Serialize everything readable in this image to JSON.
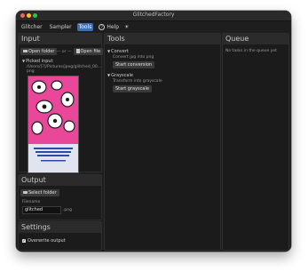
{
  "window": {
    "title": "GlitchedFactory"
  },
  "menu": {
    "items": [
      "Glitcher",
      "Sampler",
      "Tools",
      "Help"
    ],
    "active": "Tools"
  },
  "input_panel": {
    "heading": "Input",
    "open_folder_label": "Open folder",
    "or_separator": "— or —",
    "open_file_label": "Open file",
    "picked_input_label": "Picked input",
    "picked_path": "/Users/[?]/Pictures/jpeg/glitched_00…",
    "picked_path_ext": "png"
  },
  "output_panel": {
    "heading": "Output",
    "select_folder_label": "Select folder",
    "filename_label": "Filename",
    "filename_value": "glitched",
    "extension": ".png"
  },
  "settings_panel": {
    "heading": "Settings",
    "overwrite_label": "Overwrite output",
    "overwrite_checked": true
  },
  "tools_panel": {
    "heading": "Tools",
    "convert": {
      "title": "Convert",
      "description": "Convert jpg into png",
      "button": "Start conversion"
    },
    "grayscale": {
      "title": "Grayscale",
      "description": "Transform into grayscale",
      "button": "Start grayscale"
    }
  },
  "queue_panel": {
    "heading": "Queue",
    "empty_text": "No tasks in the queue yet"
  },
  "preview": {
    "caption": "[illegible poster text]"
  },
  "colors": {
    "window_bg": "#1e1e1e",
    "active_menu": "#3d6fb6",
    "preview_pink": "#e8479a"
  }
}
